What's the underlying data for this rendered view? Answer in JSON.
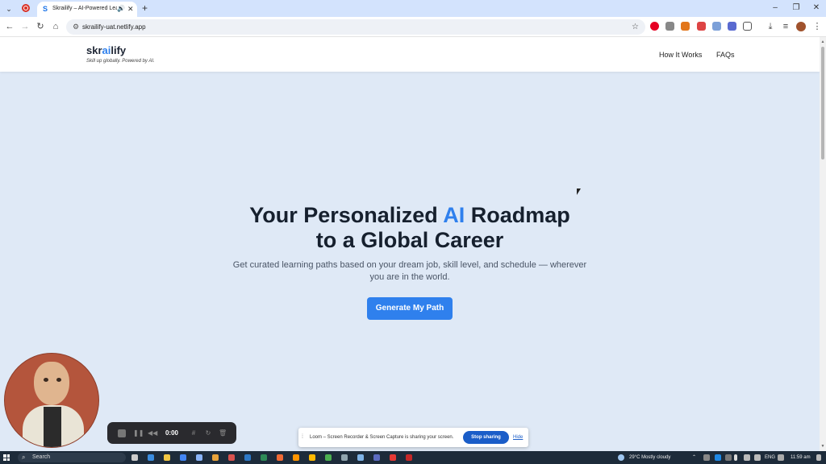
{
  "browser": {
    "tab_title": "Skrailify – AI-Powered Learn",
    "tab_favicon": "S",
    "url": "skrailify-uat.netlify.app"
  },
  "site": {
    "logo_pre": "skr",
    "logo_ai": "ai",
    "logo_post": "lify",
    "tagline": "Skill up globally. Powered by AI.",
    "nav": [
      "How It Works",
      "FAQs"
    ]
  },
  "hero": {
    "title_pre": "Your Personalized ",
    "title_accent": "AI",
    "title_post": " Roadmap",
    "title_line2": "to a Global Career",
    "subtitle": "Get curated learning paths based on your dream job, skill level, and schedule — wherever you are in the world.",
    "cta": "Generate My Path"
  },
  "loom": {
    "time": "0:00",
    "share_message": "Loom – Screen Recorder & Screen Capture is sharing your screen.",
    "stop_label": "Stop sharing",
    "hide_label": "Hide"
  },
  "taskbar": {
    "search_label": "Search",
    "weather": "29°C  Mostly cloudy",
    "lang": "ENG",
    "time": "11:59 am"
  },
  "colors": {
    "accent": "#2f80ed",
    "page_bg": "#dfe9f6",
    "heading": "#16202e"
  }
}
